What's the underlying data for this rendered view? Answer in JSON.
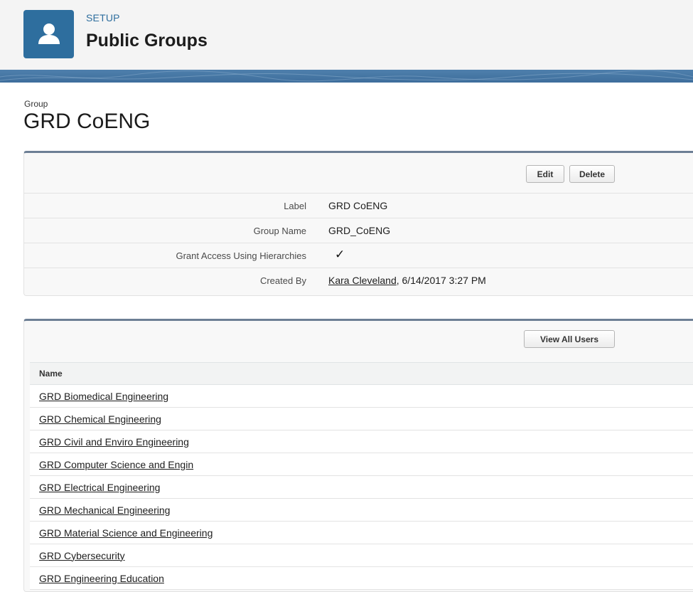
{
  "header": {
    "kicker": "SETUP",
    "title": "Public Groups"
  },
  "record": {
    "type_label": "Group",
    "name": "GRD CoENG"
  },
  "detail": {
    "buttons": {
      "edit": "Edit",
      "delete": "Delete"
    },
    "fields": [
      {
        "label": "Label",
        "value": "GRD CoENG"
      },
      {
        "label": "Group Name",
        "value": "GRD_CoENG"
      },
      {
        "label": "Grant Access Using Hierarchies",
        "value": "✓"
      },
      {
        "label": "Created By",
        "link": "Kara Cleveland",
        "value": ", 6/14/2017 3:27 PM"
      }
    ]
  },
  "related": {
    "button": "View All Users",
    "column_header": "Name",
    "rows": [
      "GRD Biomedical Engineering",
      "GRD Chemical Engineering",
      "GRD Civil and Enviro Engineering",
      "GRD Computer Science and Engin",
      "GRD Electrical Engineering",
      "GRD Mechanical Engineering",
      "GRD Material Science and Engineering",
      "GRD Cybersecurity",
      "GRD Engineering Education"
    ]
  },
  "colors": {
    "brand_blue": "#2e6e9e",
    "panel_border": "#6d7f95",
    "background": "#ffffff"
  },
  "icons": {
    "setup_icon": "user-group-icon",
    "checkbox": "checkmark-icon"
  }
}
